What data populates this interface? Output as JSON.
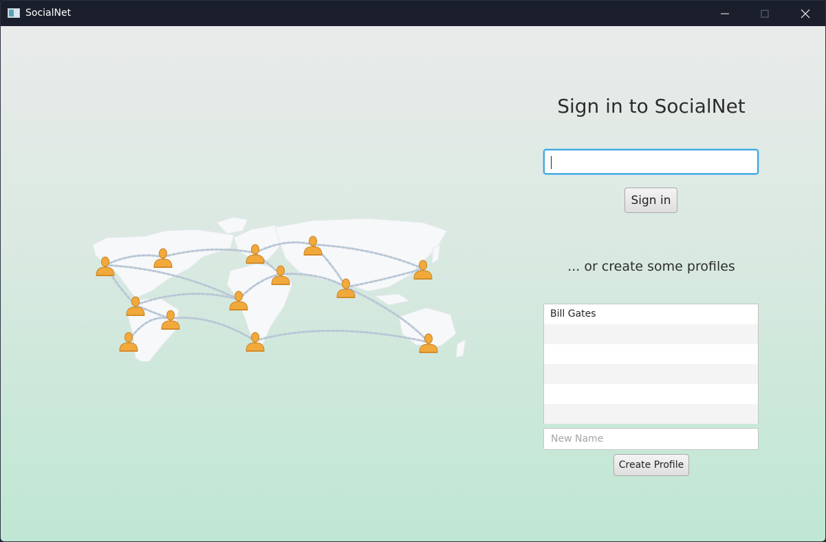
{
  "window": {
    "title": "SocialNet"
  },
  "signin": {
    "heading": "Sign in to SocialNet",
    "input_value": "",
    "button_label": "Sign in"
  },
  "profiles": {
    "heading": "... or create some profiles",
    "items": [
      "Bill Gates",
      "",
      "",
      "",
      "",
      ""
    ],
    "new_name_placeholder": "New Name",
    "new_name_value": "",
    "create_button_label": "Create Profile"
  },
  "colors": {
    "titlebar": "#1b1f2c",
    "background_top": "#e9ebea",
    "background_bottom": "#bfe7d3",
    "focus_ring": "#3aa7e0",
    "user_icon": "#f2a93b"
  },
  "icons": {
    "app": "window-app-icon",
    "minimize": "minimize-icon",
    "maximize": "maximize-icon",
    "close": "close-icon",
    "illustration": "world-map-users-illustration",
    "user": "user-icon"
  }
}
